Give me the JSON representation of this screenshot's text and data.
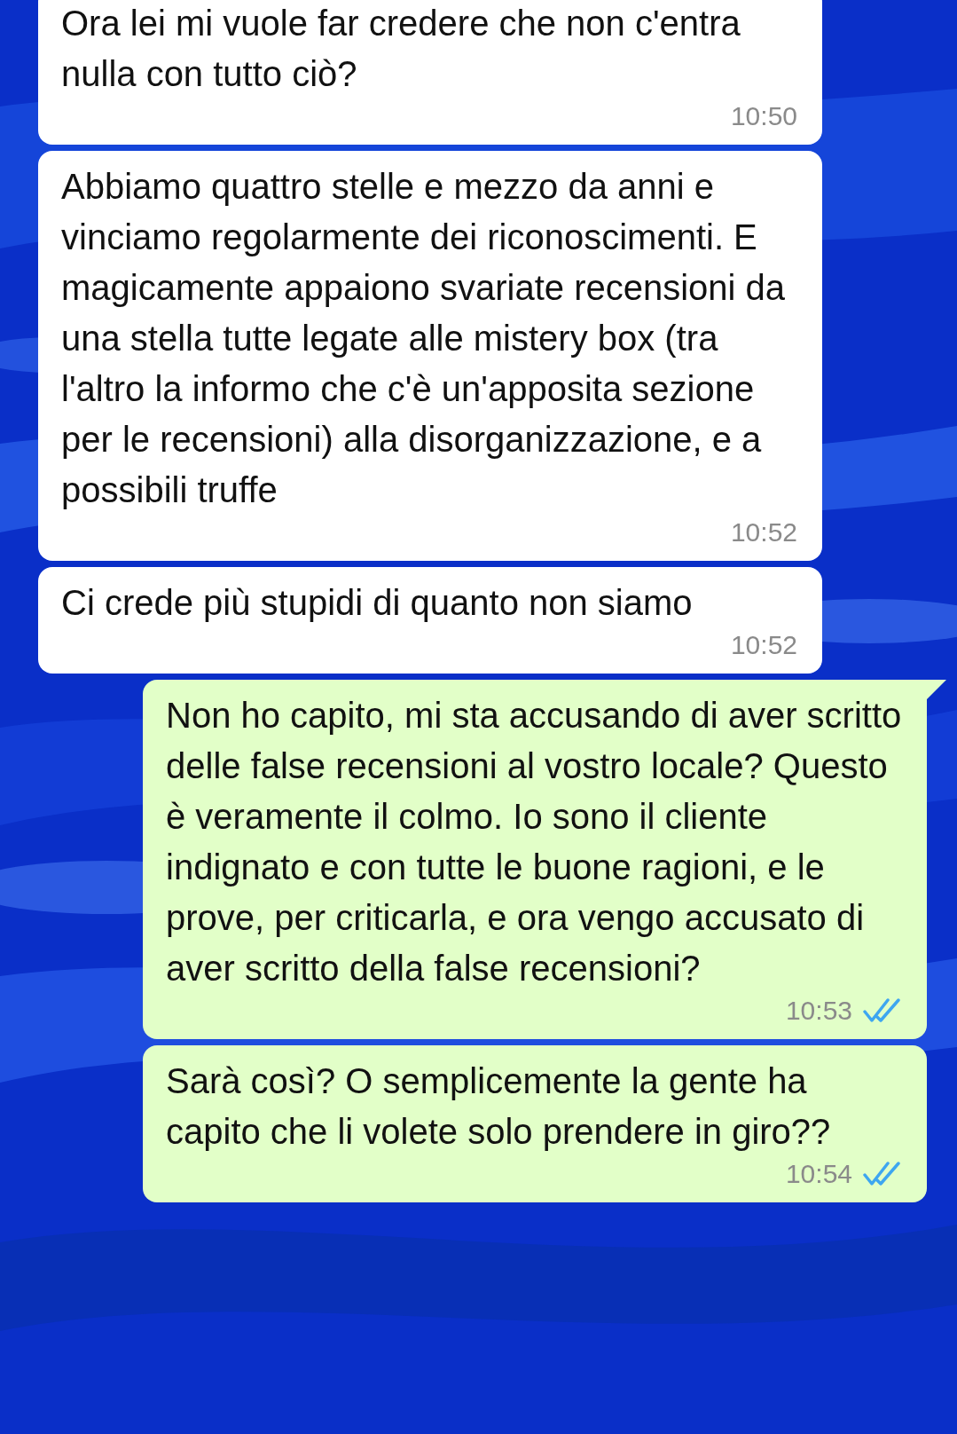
{
  "messages": [
    {
      "kind": "incoming",
      "text": "Ora lei mi vuole far credere che non c'entra nulla con tutto ciò?",
      "time": "10:50"
    },
    {
      "kind": "incoming",
      "text": "Abbiamo quattro stelle e mezzo da anni e vinciamo regolarmente dei riconoscimenti. E magicamente appaiono svariate recensioni da una stella tutte legate alle mistery box (tra l'altro la informo che c'è un'apposita sezione per le recensioni) alla disorganizzazione, e a possibili truffe",
      "time": "10:52"
    },
    {
      "kind": "incoming",
      "text": "Ci crede più stupidi di quanto non siamo",
      "time": "10:52"
    },
    {
      "kind": "outgoing",
      "text": "Non ho capito, mi sta accusando di aver scritto delle false recensioni al vostro locale? Questo è veramente il colmo. Io sono il cliente indignato e con tutte le buone ragioni, e le prove, per criticarla, e ora vengo accusato di aver scritto della false recensioni?",
      "time": "10:53",
      "read": true,
      "tail": true
    },
    {
      "kind": "outgoing",
      "text": "Sarà così? O semplicemente la gente ha capito che li volete solo prendere in giro??",
      "time": "10:54",
      "read": true,
      "tail": false
    }
  ]
}
